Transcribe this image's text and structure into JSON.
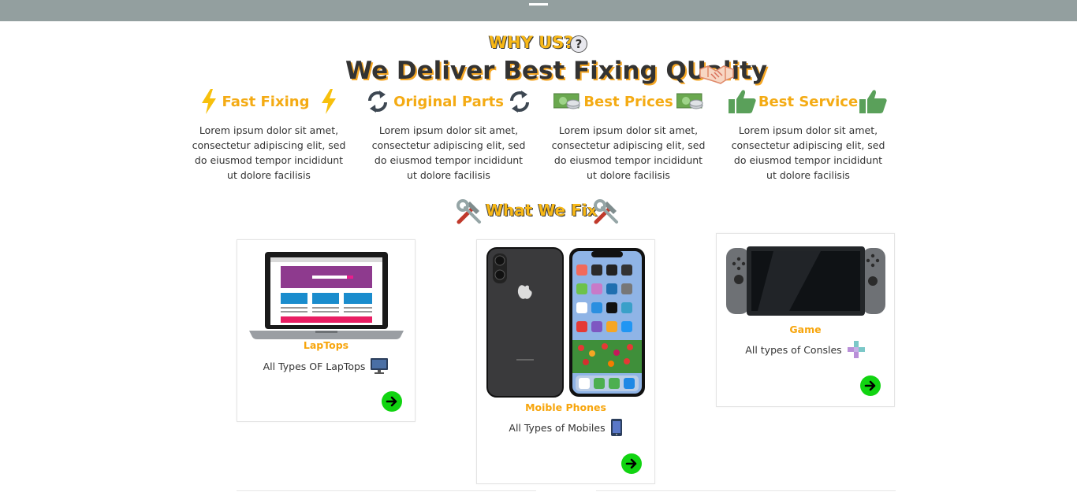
{
  "header": {
    "menu_icon": "hamburger-menu-icon"
  },
  "why": {
    "title": "WHY US?",
    "help_glyph": "?",
    "subtitle": "We Deliver Best Fixing QUality"
  },
  "features": [
    {
      "title": "Fast Fixing",
      "icon": "lightning-icon",
      "text": "Lorem ipsum dolor sit amet, consectetur adipiscing elit, sed do eiusmod tempor incididunt ut dolore facilisis"
    },
    {
      "title": "Original Parts",
      "icon": "sync-icon",
      "text": "Lorem ipsum dolor sit amet, consectetur adipiscing elit, sed do eiusmod tempor incididunt ut dolore facilisis"
    },
    {
      "title": "Best Prices",
      "icon": "money-icon",
      "text": "Lorem ipsum dolor sit amet, consectetur adipiscing elit, sed do eiusmod tempor incididunt ut dolore facilisis"
    },
    {
      "title": "Best Service",
      "icon": "thumbs-up-icon",
      "text": "Lorem ipsum dolor sit amet, consectetur adipiscing elit, sed do eiusmod tempor incididunt ut dolore facilisis"
    }
  ],
  "fix": {
    "title": "What We Fix"
  },
  "cards": [
    {
      "title": "LapTops",
      "desc": "All Types OF LapTops",
      "image": "laptop-image",
      "icon": "desktop-icon"
    },
    {
      "title": "Moible Phones",
      "desc": "All Types of Mobiles",
      "image": "phone-image",
      "icon": "mobile-icon"
    },
    {
      "title": "Game",
      "desc": "All types of Consles",
      "image": "game-console-image",
      "icon": "gamepad-icon"
    }
  ],
  "colors": {
    "topbar": "#939f9f",
    "accent": "#f4ab14",
    "arrow": "#11d411"
  }
}
